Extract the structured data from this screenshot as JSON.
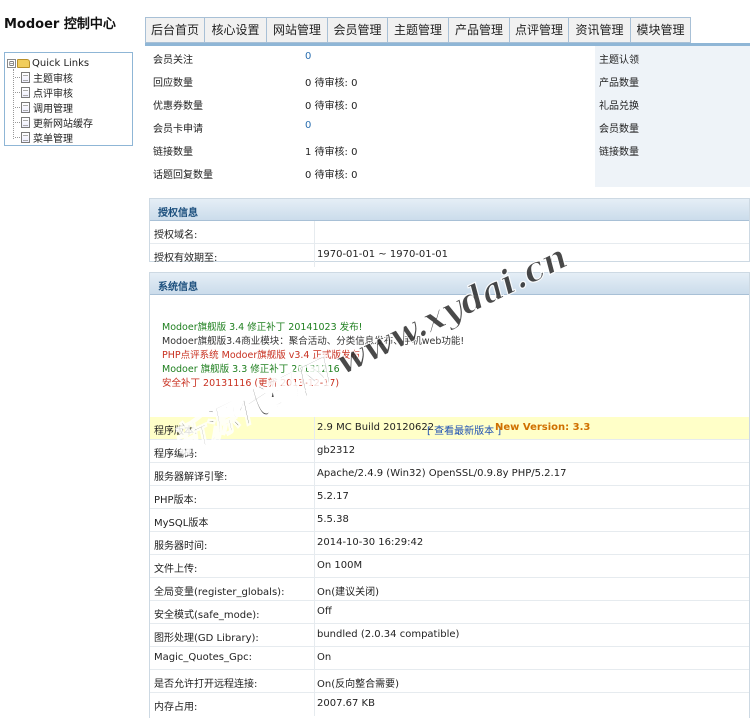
{
  "header": {
    "app_title": "Modoer 控制中心"
  },
  "sidebar": {
    "root_label": "Quick Links",
    "expander_glyph": "⊟",
    "items": [
      {
        "label": "主题审核"
      },
      {
        "label": "点评审核"
      },
      {
        "label": "调用管理"
      },
      {
        "label": "更新网站缓存"
      },
      {
        "label": "菜单管理"
      }
    ]
  },
  "tabs": [
    {
      "label": "后台首页"
    },
    {
      "label": "核心设置"
    },
    {
      "label": "网站管理"
    },
    {
      "label": "会员管理"
    },
    {
      "label": "主题管理"
    },
    {
      "label": "产品管理"
    },
    {
      "label": "点评管理"
    },
    {
      "label": "资讯管理"
    },
    {
      "label": "模块管理"
    }
  ],
  "stats": [
    {
      "label": "会员关注",
      "value": "0",
      "right_label": "主题认领"
    },
    {
      "label": "回应数量",
      "value": "0 待审核: 0",
      "right_label": "产品数量"
    },
    {
      "label": "优惠券数量",
      "value": "0 待审核: 0",
      "right_label": "礼品兑换"
    },
    {
      "label": "会员卡申请",
      "value": "0",
      "right_label": "会员数量"
    },
    {
      "label": "链接数量",
      "value": "1 待审核: 0",
      "right_label": "链接数量"
    },
    {
      "label": "话题回复数量",
      "value": "0 待审核: 0",
      "right_label": ""
    }
  ],
  "auth": {
    "title": "授权信息",
    "rows": [
      {
        "label": "授权域名:",
        "value": ""
      },
      {
        "label": "授权有效期至:",
        "value": "1970-01-01 ~ 1970-01-01"
      }
    ]
  },
  "system": {
    "title": "系统信息",
    "news": [
      {
        "text": "Modoer旗舰版 3.4 修正补丁 20141023 发布!",
        "color": "green"
      },
      {
        "text": "Modoer旗舰版3.4商业模块：聚合活动、分类信息发布、手机web功能!",
        "color": "dark"
      },
      {
        "text": "PHP点评系统 Modoer旗舰版 v3.4 正式版发布",
        "color": "red"
      },
      {
        "text": "Modoer 旗舰版 3.3 修正补丁 20131216",
        "color": "green"
      },
      {
        "text": "安全补丁 20131116 (更新 2013-12-17)",
        "color": "red"
      }
    ],
    "version_row": {
      "label": "程序版本:",
      "version": "2.9 MC Build 20120622",
      "check_link": "[ 查看最新版本 ]",
      "new_version": "New Version: 3.3"
    },
    "rows": [
      {
        "label": "程序编码:",
        "value": "gb2312"
      },
      {
        "label": "服务器解译引擎:",
        "value": "Apache/2.4.9 (Win32) OpenSSL/0.9.8y PHP/5.2.17"
      },
      {
        "label": "PHP版本:",
        "value": "5.2.17"
      },
      {
        "label": "MySQL版本",
        "value": "5.5.38"
      },
      {
        "label": "服务器时间:",
        "value": "2014-10-30 16:29:42"
      },
      {
        "label": "文件上传:",
        "value": "On 100M"
      },
      {
        "label": "全局变量(register_globals):",
        "value": "On(建议关闭)"
      },
      {
        "label": "安全模式(safe_mode):",
        "value": "Off"
      },
      {
        "label": "图形处理(GD Library):",
        "value": "bundled (2.0.34 compatible)"
      },
      {
        "label": "Magic_Quotes_Gpc:",
        "value": "On"
      },
      {
        "label": "是否允许打开远程连接:",
        "value": "On(反向整合需要)"
      },
      {
        "label": "内存占用:",
        "value": "2007.67 KB"
      }
    ]
  },
  "watermark": {
    "text": "新源代码网 www.xydai.cn"
  },
  "colors": {
    "border_blue": "#8fb6d6",
    "news_green": "#208020",
    "news_red": "#c83020",
    "new_version_orange": "#d07000",
    "highlight_yellow": "#ffffc8"
  }
}
